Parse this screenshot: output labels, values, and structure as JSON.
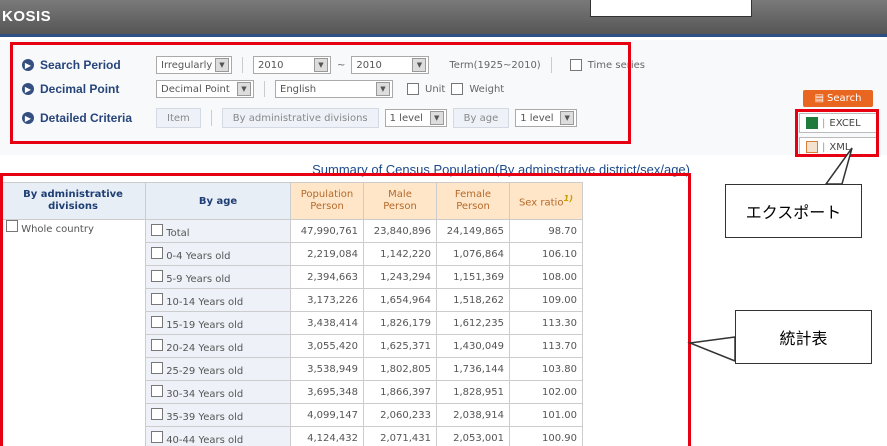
{
  "header": {
    "logo": "KOSIS"
  },
  "search": {
    "period_label": "Search Period",
    "period_type": "Irregularly",
    "from_year": "2010",
    "to_prefix": "~",
    "to_year": "2010",
    "term": "Term(1925~2010)",
    "time_series_label": "Time series",
    "decimal_label": "Decimal Point",
    "decimal_value": "Decimal Point",
    "language": "English",
    "unit_label": "Unit",
    "weight_label": "Weight",
    "criteria_label": "Detailed Criteria",
    "item_label": "Item",
    "admin_label": "By administrative divisions",
    "admin_level": "1 level",
    "age_label": "By age",
    "age_level": "1 level"
  },
  "buttons": {
    "search": "Search",
    "excel": "EXCEL",
    "xml": "XML"
  },
  "table": {
    "title": "Summary of Census Population(By adminstrative district/sex/age)",
    "headers": {
      "admin": "By administrative divisions",
      "age": "By age",
      "pop": "Population",
      "male": "Male",
      "female": "Female",
      "ratio": "Sex ratio",
      "ratio_sup": "1)",
      "unit": "Person"
    },
    "region": "Whole country",
    "rows": [
      {
        "age": "Total",
        "pop": "47,990,761",
        "male": "23,840,896",
        "female": "24,149,865",
        "ratio": "98.70"
      },
      {
        "age": "0-4 Years old",
        "pop": "2,219,084",
        "male": "1,142,220",
        "female": "1,076,864",
        "ratio": "106.10"
      },
      {
        "age": "5-9 Years old",
        "pop": "2,394,663",
        "male": "1,243,294",
        "female": "1,151,369",
        "ratio": "108.00"
      },
      {
        "age": "10-14 Years old",
        "pop": "3,173,226",
        "male": "1,654,964",
        "female": "1,518,262",
        "ratio": "109.00"
      },
      {
        "age": "15-19 Years old",
        "pop": "3,438,414",
        "male": "1,826,179",
        "female": "1,612,235",
        "ratio": "113.30"
      },
      {
        "age": "20-24 Years old",
        "pop": "3,055,420",
        "male": "1,625,371",
        "female": "1,430,049",
        "ratio": "113.70"
      },
      {
        "age": "25-29 Years old",
        "pop": "3,538,949",
        "male": "1,802,805",
        "female": "1,736,144",
        "ratio": "103.80"
      },
      {
        "age": "30-34 Years old",
        "pop": "3,695,348",
        "male": "1,866,397",
        "female": "1,828,951",
        "ratio": "102.00"
      },
      {
        "age": "35-39 Years old",
        "pop": "4,099,147",
        "male": "2,060,233",
        "female": "2,038,914",
        "ratio": "101.00"
      },
      {
        "age": "40-44 Years old",
        "pop": "4,124,432",
        "male": "2,071,431",
        "female": "2,053,001",
        "ratio": "100.90"
      }
    ]
  },
  "annotations": {
    "export": "エクスポート",
    "stats": "統計表"
  },
  "colors": {
    "highlight": "#e60012",
    "header_bar": "#555555",
    "search_button": "#e8661f"
  }
}
